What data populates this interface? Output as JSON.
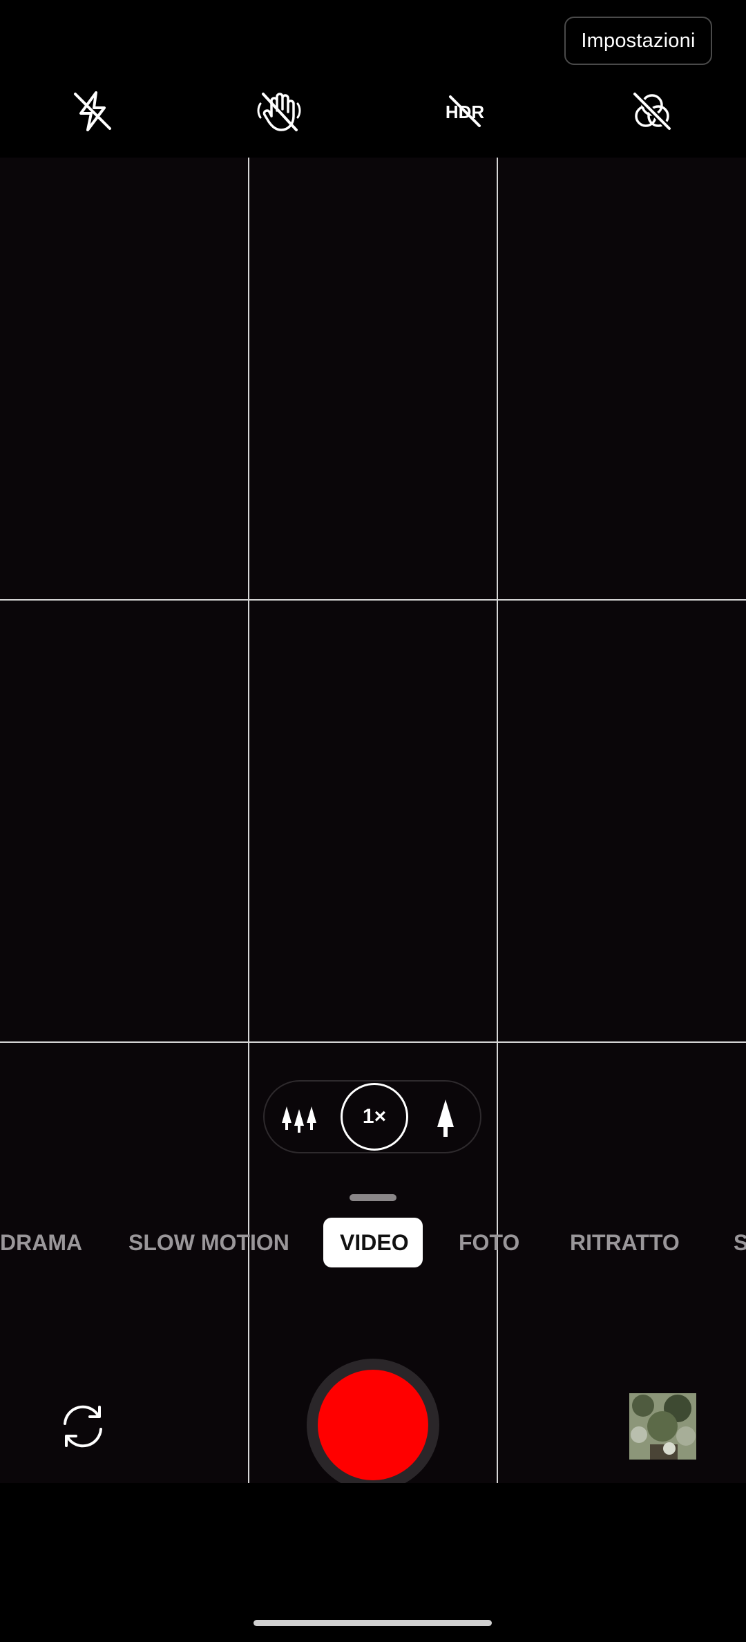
{
  "header": {
    "settings_label": "Impostazioni"
  },
  "quick_settings": [
    {
      "icon": "flash-off-icon"
    },
    {
      "icon": "gesture-off-icon"
    },
    {
      "icon": "hdr-off-icon",
      "text": "HDR"
    },
    {
      "icon": "filter-off-icon"
    }
  ],
  "zoom": {
    "options": [
      "wide-angle-icon",
      "1×",
      "telephoto-icon"
    ],
    "selected_label": "1×"
  },
  "modes": {
    "items": [
      "DRAMA",
      "SLOW MOTION",
      "VIDEO",
      "FOTO",
      "RITRATTO",
      "S"
    ],
    "selected": "VIDEO"
  },
  "controls": {
    "flip_icon": "camera-flip-icon",
    "shutter_color": "#ff0000",
    "gallery": "gallery-thumbnail"
  },
  "colors": {
    "viewfinder": "#0a0609",
    "record": "#ff0000"
  }
}
